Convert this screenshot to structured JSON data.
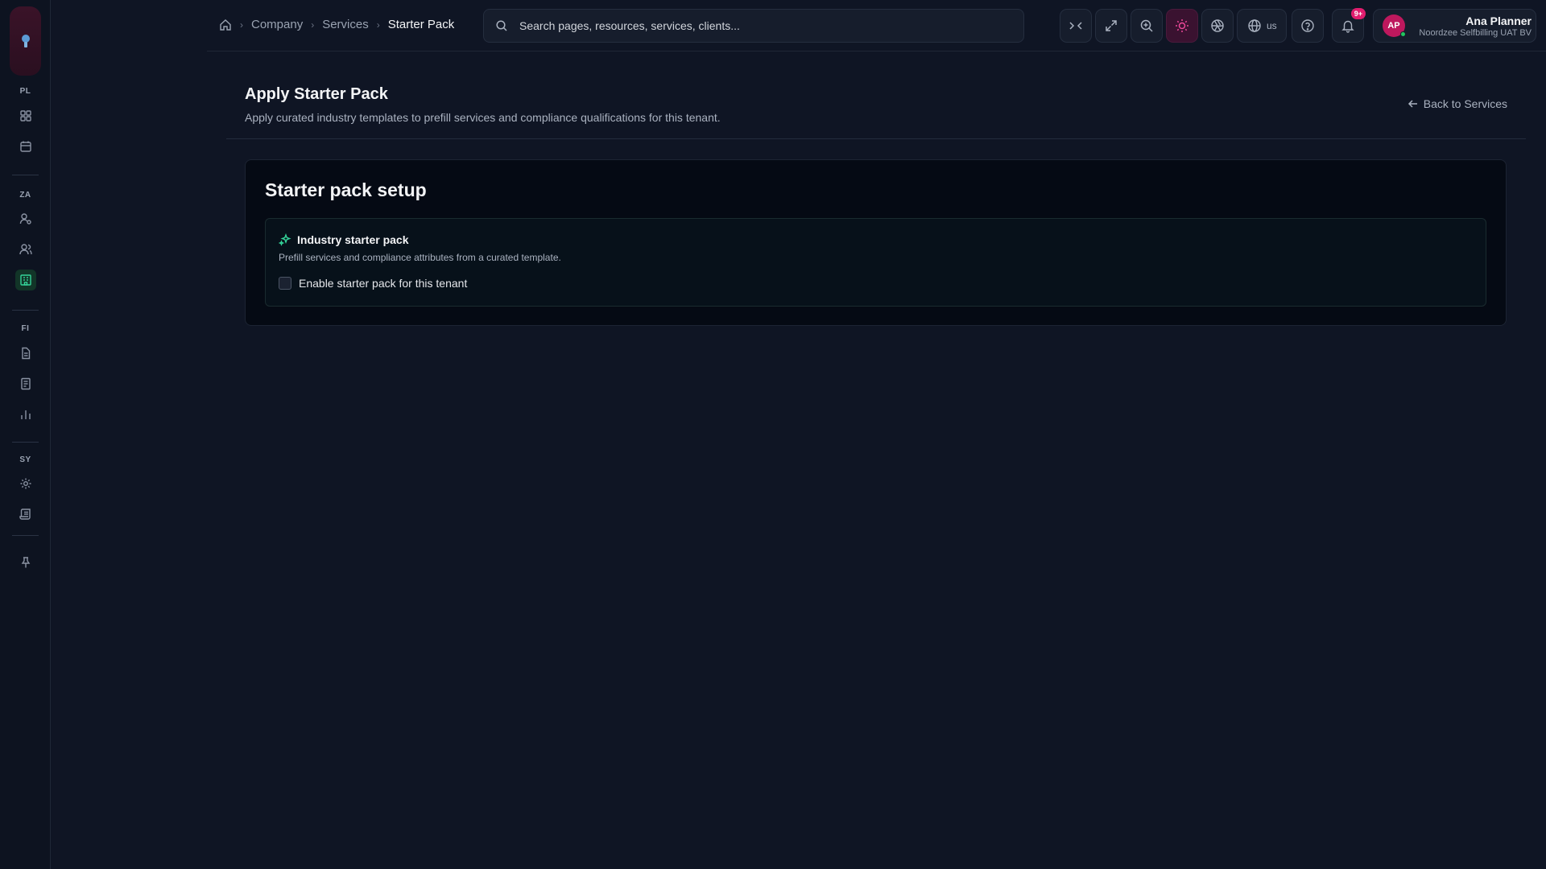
{
  "sidebar": {
    "sections": [
      {
        "label": "PL",
        "items": [
          {
            "icon": "dashboard-icon"
          },
          {
            "icon": "calendar-icon"
          }
        ]
      },
      {
        "label": "ZA",
        "items": [
          {
            "icon": "user-settings-icon"
          },
          {
            "icon": "users-icon"
          },
          {
            "icon": "building-icon",
            "active": true
          }
        ]
      },
      {
        "label": "FI",
        "items": [
          {
            "icon": "document-icon"
          },
          {
            "icon": "invoice-icon"
          },
          {
            "icon": "bar-chart-icon"
          }
        ]
      },
      {
        "label": "SY",
        "items": [
          {
            "icon": "gear-icon"
          },
          {
            "icon": "scroll-icon"
          }
        ]
      }
    ],
    "pin_icon": "pin-icon"
  },
  "breadcrumb": {
    "items": [
      "Company",
      "Services"
    ],
    "current": "Starter Pack"
  },
  "search": {
    "placeholder": "Search pages, resources, services, clients..."
  },
  "toolbar": {
    "language": "us",
    "notifications_badge": "9+"
  },
  "user": {
    "initials": "AP",
    "name": "Ana Planner",
    "org": "Noordzee Selfbilling UAT BV"
  },
  "page": {
    "title": "Apply Starter Pack",
    "subtitle": "Apply curated industry templates to prefill services and compliance qualifications for this tenant.",
    "back_label": "Back to Services"
  },
  "card": {
    "title": "Starter pack setup",
    "section_title": "Industry starter pack",
    "section_desc": "Prefill services and compliance attributes from a curated template.",
    "checkbox_label": "Enable starter pack for this tenant",
    "checkbox_checked": false
  },
  "colors": {
    "background": "#0f1524",
    "accent_green": "#34d399",
    "accent_pink": "#ec4899"
  }
}
